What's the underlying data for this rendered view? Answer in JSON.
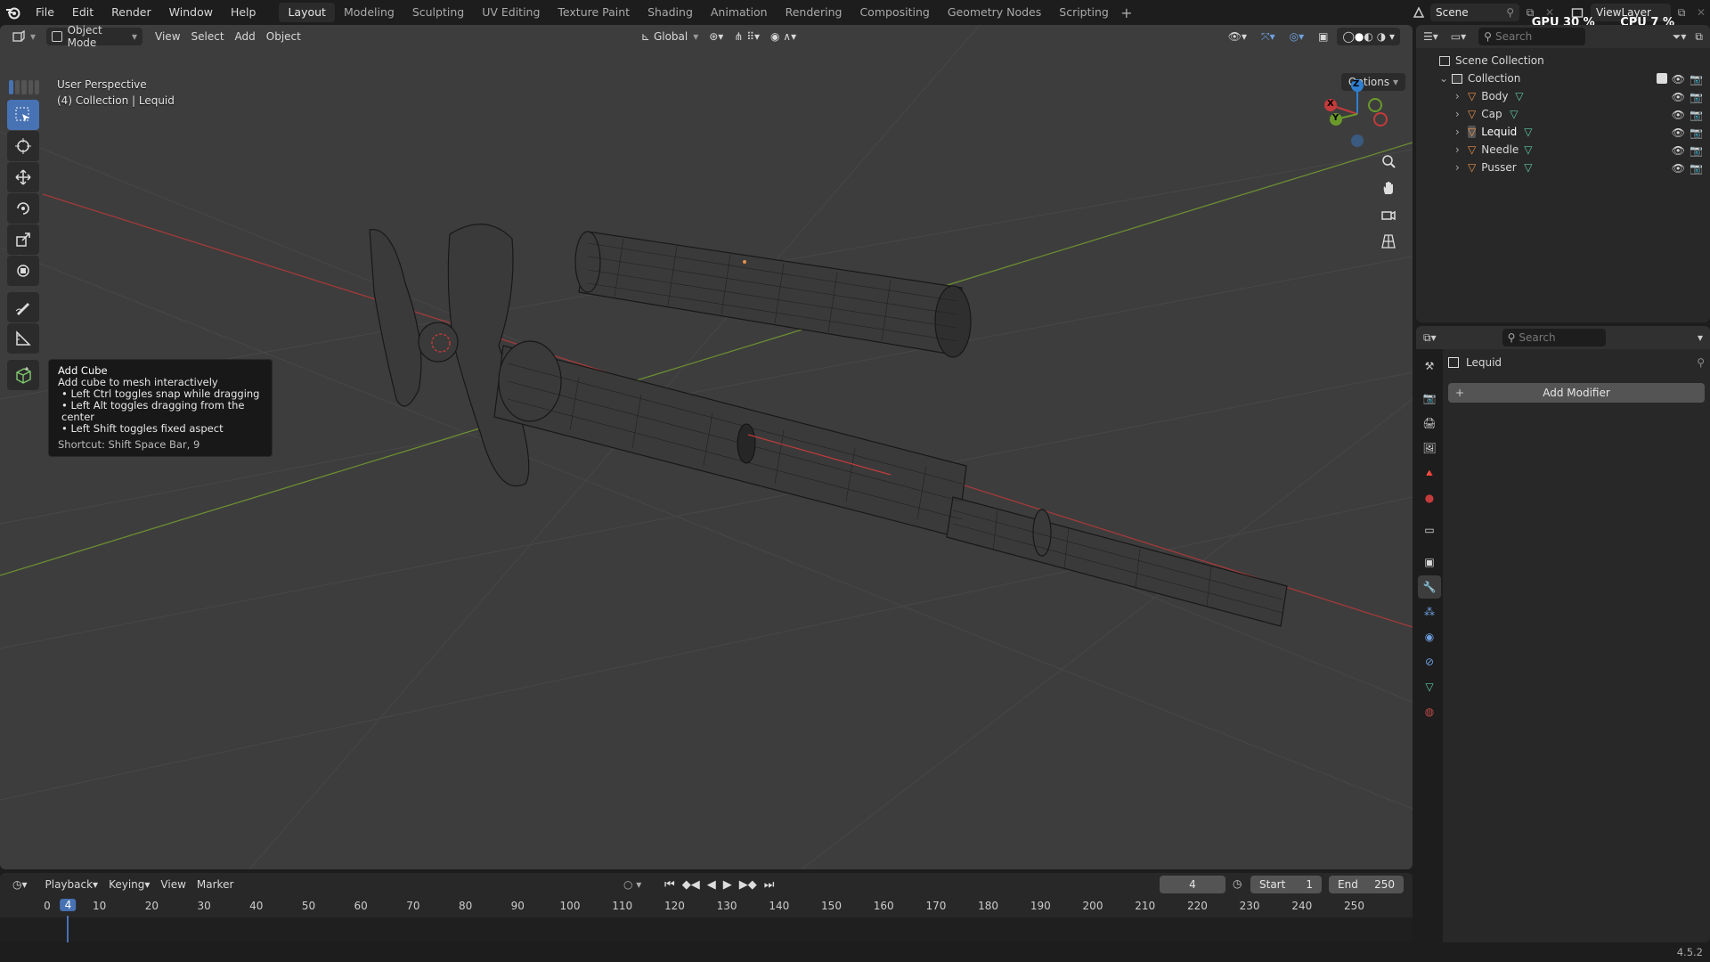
{
  "menu": [
    "File",
    "Edit",
    "Render",
    "Window",
    "Help"
  ],
  "workspaces": [
    "Layout",
    "Modeling",
    "Sculpting",
    "UV Editing",
    "Texture Paint",
    "Shading",
    "Animation",
    "Rendering",
    "Compositing",
    "Geometry Nodes",
    "Scripting"
  ],
  "active_workspace": "Layout",
  "scene": "Scene",
  "view_layer": "ViewLayer",
  "stats": {
    "gpu_label": "GPU",
    "gpu_value": "30 %",
    "cpu_label": "CPU",
    "cpu_value": "7 %"
  },
  "viewport_header": {
    "mode": "Object Mode",
    "view": "View",
    "select": "Select",
    "add": "Add",
    "object": "Object",
    "orientation": "Global",
    "options": "Options"
  },
  "viewport_info": {
    "line1": "User Perspective",
    "line2": "(4) Collection | Lequid"
  },
  "tooltip": {
    "title": "Add Cube",
    "desc": "Add cube to mesh interactively",
    "bullets": [
      "Left Ctrl toggles snap while dragging",
      "Left Alt toggles dragging from the center",
      "Left Shift toggles fixed aspect"
    ],
    "shortcut": "Shortcut: Shift Space Bar, 9"
  },
  "gizmo": {
    "z": "Z",
    "x": "X",
    "y": "Y"
  },
  "outliner": {
    "search_placeholder": "Search",
    "scene_collection": "Scene Collection",
    "collection": "Collection",
    "objects": [
      "Body",
      "Cap",
      "Lequid",
      "Needle",
      "Pusser"
    ],
    "active_object": "Lequid"
  },
  "properties": {
    "search_placeholder": "Search",
    "object_name": "Lequid",
    "add_modifier": "Add Modifier"
  },
  "timeline": {
    "playback": "Playback",
    "keying": "Keying",
    "view": "View",
    "marker": "Marker",
    "current_frame": "4",
    "start_label": "Start",
    "start": "1",
    "end_label": "End",
    "end": "250",
    "ticks": [
      "0",
      "10",
      "20",
      "30",
      "40",
      "50",
      "60",
      "70",
      "80",
      "90",
      "100",
      "110",
      "120",
      "130",
      "140",
      "150",
      "160",
      "170",
      "180",
      "190",
      "200",
      "210",
      "220",
      "230",
      "240",
      "250"
    ],
    "playhead": "4"
  },
  "version": "4.5.2",
  "colors": {
    "accent": "#4772b3",
    "x_axis": "#c33b3b",
    "y_axis": "#6a9a2a",
    "z_axis": "#2f7fd1",
    "mesh_icon": "#e8914b",
    "data_icon": "#5fc9a6"
  }
}
